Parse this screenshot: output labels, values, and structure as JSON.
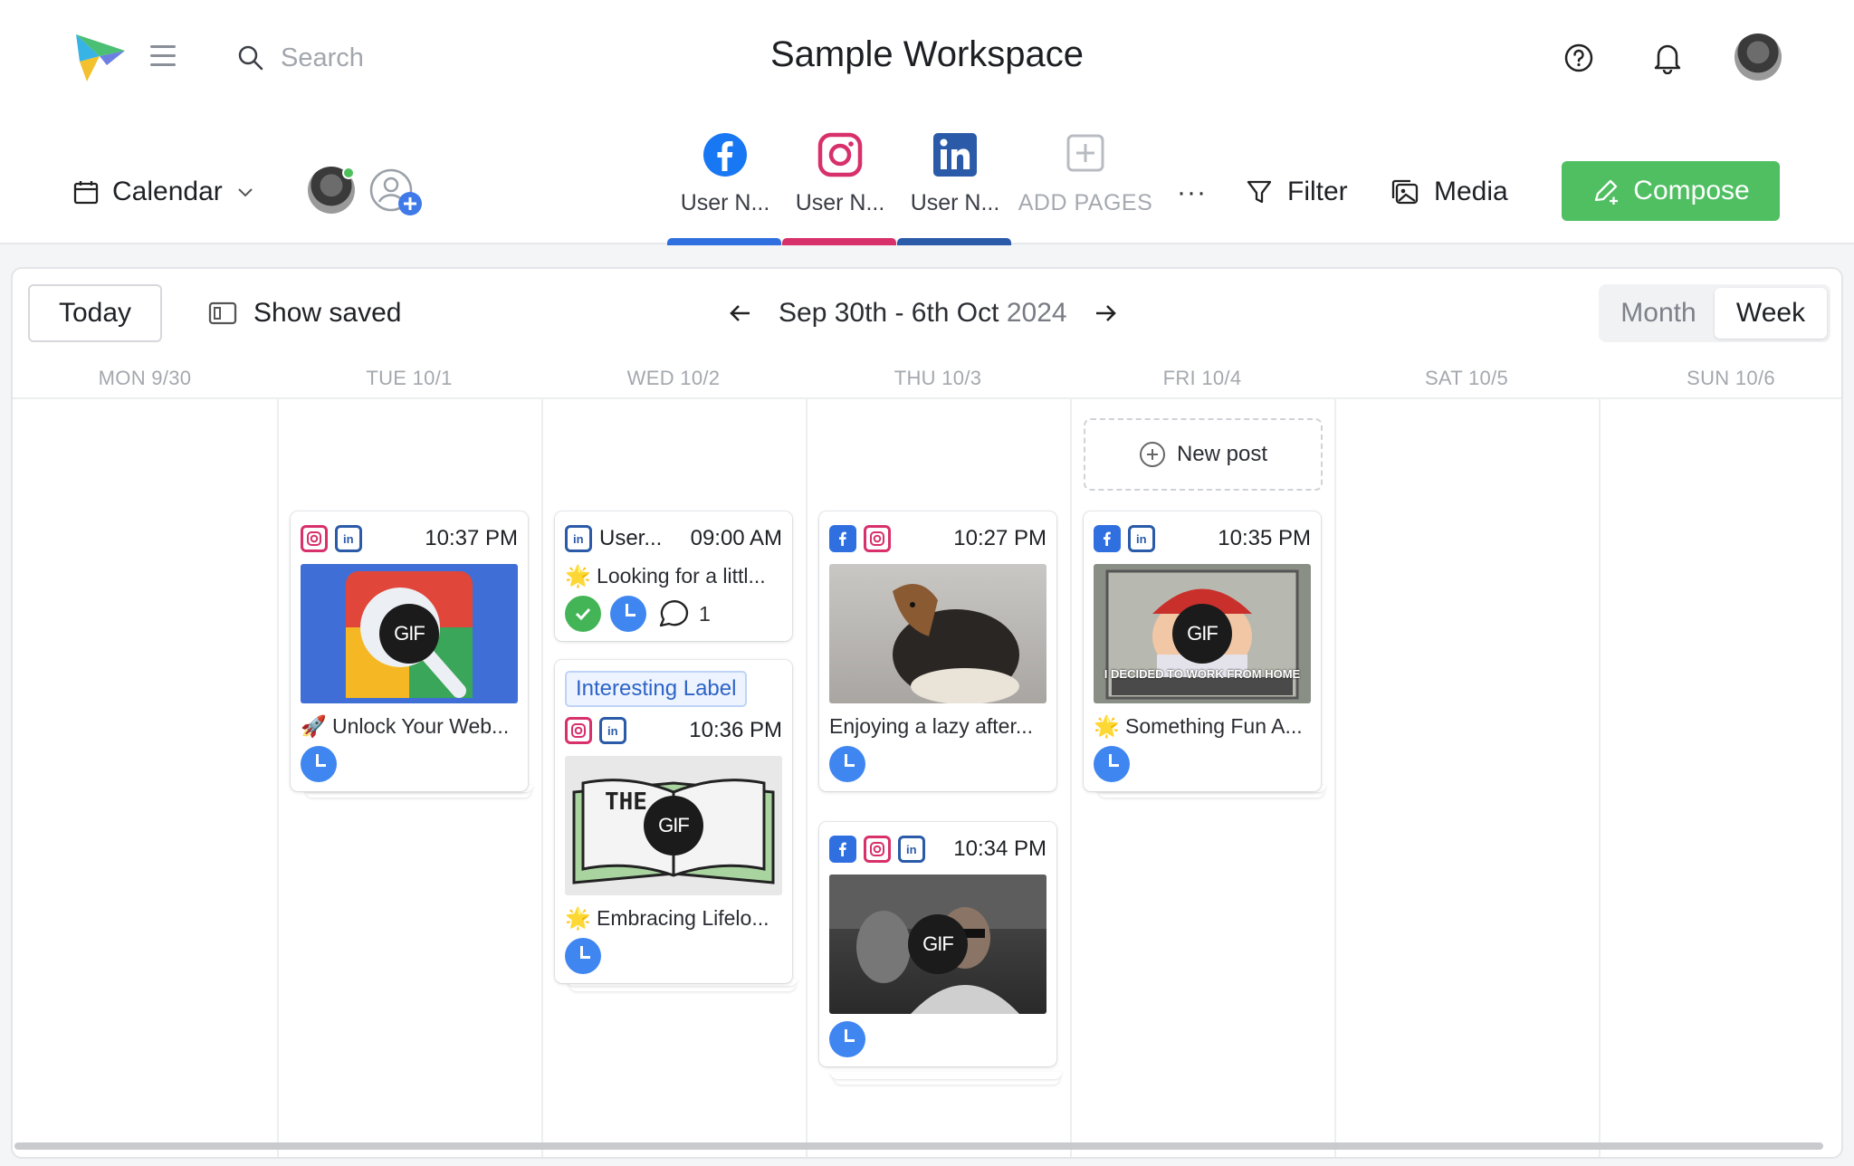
{
  "header": {
    "search_placeholder": "Search",
    "workspace_title": "Sample Workspace",
    "calendar_label": "Calendar",
    "pages": [
      {
        "label": "User N...",
        "network": "facebook",
        "color": "#2f6fe0"
      },
      {
        "label": "User N...",
        "network": "instagram",
        "color": "#d8306a"
      },
      {
        "label": "User N...",
        "network": "linkedin",
        "color": "#2a5aa8"
      }
    ],
    "add_pages_label": "ADD PAGES",
    "more_label": "···",
    "filter_label": "Filter",
    "media_label": "Media",
    "compose_label": "Compose"
  },
  "toolbar": {
    "today_label": "Today",
    "show_saved_label": "Show saved",
    "date_range": "Sep 30th - 6th Oct",
    "date_year": "2024",
    "view_month": "Month",
    "view_week": "Week"
  },
  "days": [
    "MON 9/30",
    "TUE 10/1",
    "WED 10/2",
    "THU 10/3",
    "FRI 10/4",
    "SAT 10/5",
    "SUN 10/6"
  ],
  "new_post_label": "New post",
  "posts": {
    "tue1": {
      "time": "10:37 PM",
      "caption": "🚀 Unlock Your Web...",
      "gif": "GIF"
    },
    "wed1": {
      "user": "User...",
      "time": "09:00 AM",
      "caption": "🌟 Looking for a littl...",
      "comments": "1"
    },
    "wed2": {
      "label": "Interesting Label",
      "time": "10:36 PM",
      "caption": "🌟 Embracing Lifelo...",
      "gif": "GIF",
      "thumb_text": "THE"
    },
    "thu1": {
      "time": "10:27 PM",
      "caption": "Enjoying a lazy after..."
    },
    "thu2": {
      "time": "10:34 PM",
      "gif": "GIF"
    },
    "fri1": {
      "time": "10:35 PM",
      "caption": "🌟 Something Fun A...",
      "gif": "GIF",
      "thumb_text": "I DECIDED TO WORK FROM HOME"
    }
  },
  "colors": {
    "accent": "#4fbf62",
    "facebook": "#2f6fe0",
    "instagram": "#d8306a",
    "linkedin": "#2a5aa8",
    "clock": "#3f86f1"
  }
}
